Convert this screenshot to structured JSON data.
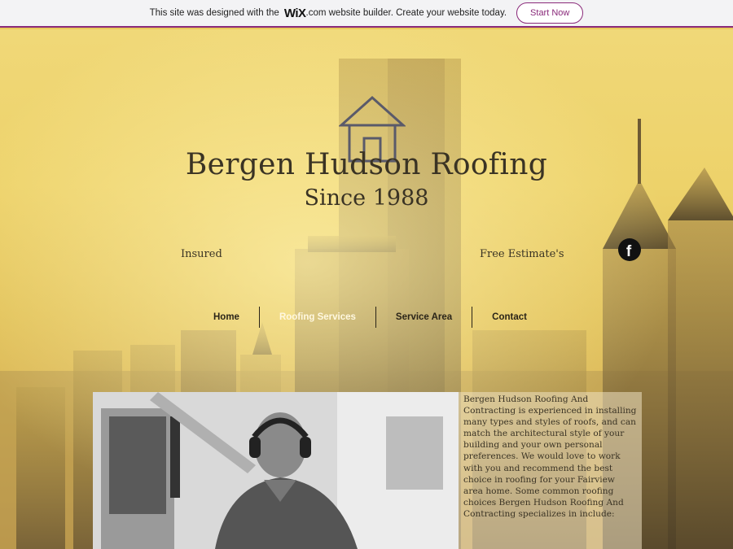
{
  "wix_banner": {
    "text_before": "This site was designed with the",
    "brand": "WiX",
    "text_after": ".com website builder. Create your website today.",
    "button": "Start Now"
  },
  "header": {
    "title": "Bergen Hudson Roofing",
    "subtitle": "Since 1988",
    "left_tag": "Insured",
    "right_tag": "Free Estimate's",
    "social_icon": "facebook-icon"
  },
  "nav": {
    "items": [
      {
        "label": "Home"
      },
      {
        "label": "Roofing Services",
        "active": true
      },
      {
        "label": "Service Area"
      },
      {
        "label": "Contact"
      }
    ]
  },
  "content": {
    "paragraph": "Bergen Hudson Roofing And Contracting is experienced in installing many types and styles of roofs, and can match the architectural style of your building and your own personal preferences. We would love to work with you and recommend the best choice in roofing for your Fairview area home. Some common roofing choices Bergen Hudson Roofing And Contracting specializes in include:"
  },
  "colors": {
    "accent": "#8a2a7a",
    "title_text": "#3a3324",
    "hero_yellow": "#edd26a"
  }
}
